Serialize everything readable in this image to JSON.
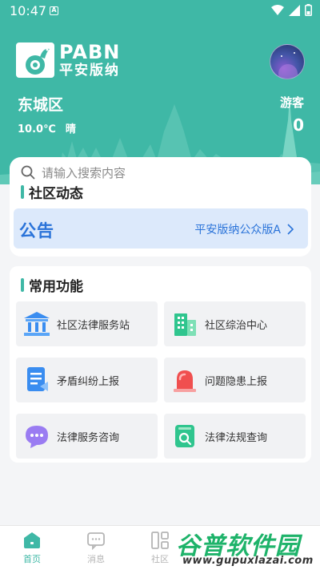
{
  "status_bar": {
    "time": "10:47",
    "notif_letter": "A"
  },
  "brand": {
    "name_en": "PABN",
    "name_cn": "平安版纳"
  },
  "location": {
    "district": "东城区",
    "temperature": "10.0℃",
    "condition": "晴"
  },
  "user": {
    "role": "游客",
    "count": "0"
  },
  "search": {
    "placeholder": "请输入搜索内容"
  },
  "community": {
    "title": "社区动态",
    "notice_tag": "公告",
    "notice_link": "平安版纳公众版A"
  },
  "functions": {
    "title": "常用功能",
    "items": [
      {
        "label": "社区法律服务站",
        "icon": "courthouse-icon"
      },
      {
        "label": "社区综治中心",
        "icon": "building-icon"
      },
      {
        "label": "矛盾纠纷上报",
        "icon": "document-report-icon"
      },
      {
        "label": "问题隐患上报",
        "icon": "alarm-siren-icon"
      },
      {
        "label": "法律服务咨询",
        "icon": "chat-bubble-icon"
      },
      {
        "label": "法律法规查询",
        "icon": "search-book-icon"
      }
    ]
  },
  "nav": {
    "items": [
      {
        "label": "首页",
        "active": true
      },
      {
        "label": "消息",
        "active": false
      },
      {
        "label": "社区",
        "active": false
      }
    ]
  },
  "watermark": {
    "title": "谷普软件园",
    "url": "www.gupuxlazai.com"
  },
  "colors": {
    "primary": "#3fb8a6",
    "notice_blue": "#2a73d9",
    "notice_bg": "#dce9fb"
  }
}
